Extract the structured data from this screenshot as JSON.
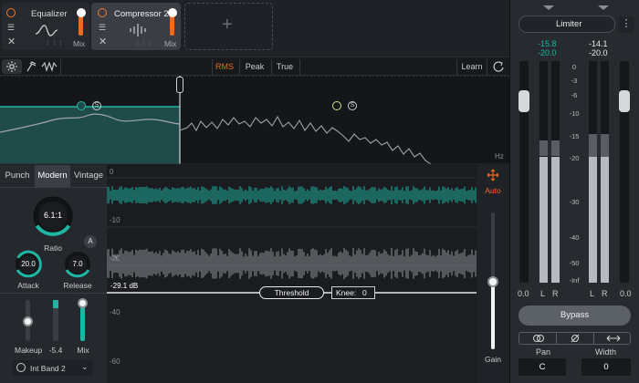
{
  "modules": [
    {
      "name": "Equalizer",
      "mix_label": "Mix",
      "mix_level": 0.9
    },
    {
      "name": "Compressor 2",
      "mix_label": "Mix",
      "mix_level": 0.9
    }
  ],
  "add_module": "+",
  "toolbar": {
    "rms": "RMS",
    "peak": "Peak",
    "true": "True",
    "learn": "Learn"
  },
  "spectrum": {
    "hz_label": "Hz",
    "solo_label": "S"
  },
  "modes": {
    "punch": "Punch",
    "modern": "Modern",
    "vintage": "Vintage"
  },
  "ratio": {
    "value": "6.1:1",
    "label": "Ratio",
    "auto_badge": "A"
  },
  "attack": {
    "value": "20.0",
    "label": "Attack"
  },
  "release": {
    "value": "7.0",
    "label": "Release"
  },
  "makeup": {
    "label": "Makeup"
  },
  "gr": {
    "value": "-5.4"
  },
  "mix": {
    "label": "Mix"
  },
  "sidechain": {
    "value": "Int Band 2"
  },
  "graph": {
    "axis": [
      "0",
      "-10",
      "-20",
      "-40",
      "-60"
    ],
    "threshold_value": "-29.1 dB",
    "threshold_label": "Threshold",
    "knee_label": "Knee:",
    "knee_value": "0"
  },
  "gain": {
    "auto": "Auto",
    "label": "Gain"
  },
  "limiter": {
    "title": "Limiter",
    "left_peak": "-15.8",
    "left_rms": "-20.0",
    "right_peak": "-14.1",
    "right_rms": "-20.0",
    "scale": [
      "0",
      "-3",
      "-6",
      "-10",
      "-15",
      "-20",
      "-30",
      "-40",
      "-50",
      "-Inf"
    ],
    "in_value": "0.0",
    "out_value": "0.0",
    "l": "L",
    "r": "R",
    "bypass": "Bypass",
    "pan_label": "Pan",
    "pan_value": "C",
    "width_label": "Width",
    "width_value": "0"
  },
  "colors": {
    "accent": "#ef6a1c",
    "teal": "#1fb5a3",
    "bg": "#1b1e22"
  }
}
